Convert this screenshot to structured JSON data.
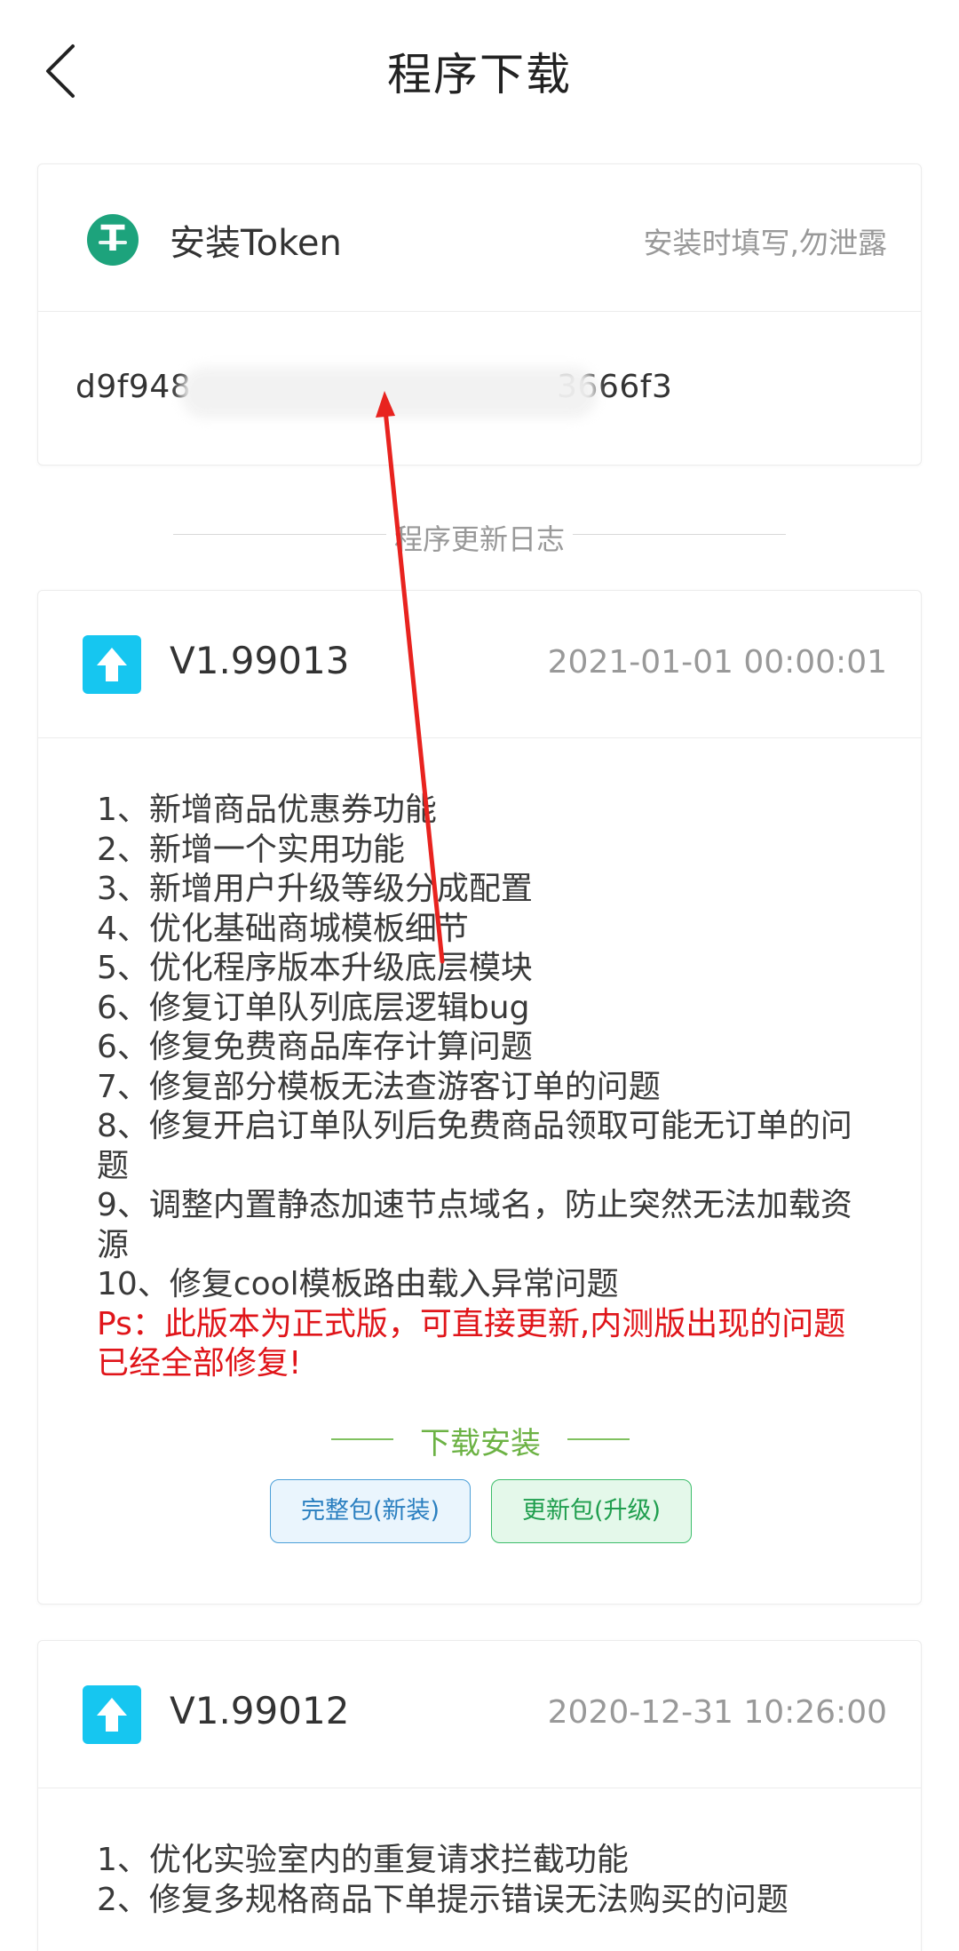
{
  "header": {
    "title": "程序下载"
  },
  "token": {
    "label": "安装Token",
    "hint": "安装时填写,勿泄露",
    "value_prefix": "d9f948",
    "value_suffix": "3666f3"
  },
  "log": {
    "heading": "程序更新日志"
  },
  "versions": [
    {
      "version": "V1.99013",
      "date": "2021-01-01 00:00:01",
      "notes": [
        "1、新增商品优惠券功能",
        "2、新增一个实用功能",
        "3、新增用户升级等级分成配置",
        "4、优化基础商城模板细节",
        "5、优化程序版本升级底层模块",
        "6、修复订单队列底层逻辑bug",
        "6、修复免费商品库存计算问题",
        "7、修复部分模板无法查游客订单的问题",
        "8、修复开启订单队列后免费商品领取可能无订单的问题",
        "9、调整内置静态加速节点域名，防止突然无法加载资源",
        "10、修复cool模板路由载入异常问题"
      ],
      "ps": "Ps：此版本为正式版，可直接更新,内测版出现的问题已经全部修复!",
      "download_heading": "下载安装",
      "btn_full": "完整包(新装)",
      "btn_update": "更新包(升级)"
    },
    {
      "version": "V1.99012",
      "date": "2020-12-31 10:26:00",
      "notes": [
        "1、优化实验室内的重复请求拦截功能",
        "2、修复多规格商品下单提示错误无法购买的问题"
      ]
    }
  ],
  "colors": {
    "accent_green": "#6cb244",
    "warning_red": "#e0151a",
    "token_icon": "#1da37c",
    "version_icon": "#16c6f0",
    "annotation_arrow": "#e8231f"
  }
}
